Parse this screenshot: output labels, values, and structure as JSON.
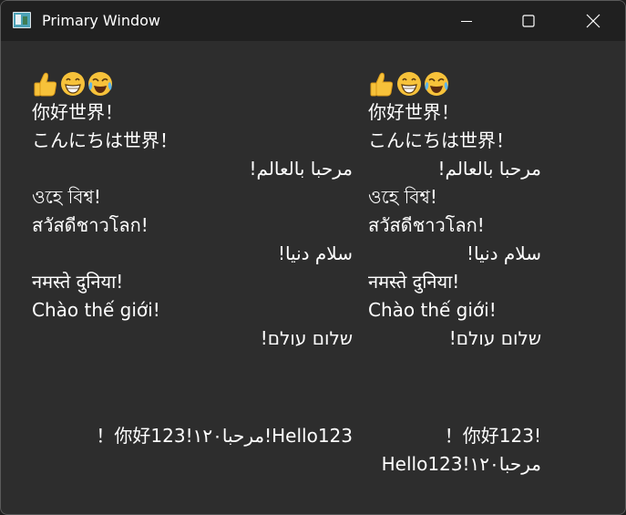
{
  "window": {
    "title": "Primary Window",
    "icons": {
      "app": "window-app-icon",
      "minimize": "minimize-icon",
      "maximize": "maximize-icon",
      "close": "close-icon"
    }
  },
  "emojis": [
    "thumbs-up-icon",
    "grinning-face-icon",
    "tears-of-joy-face-icon"
  ],
  "lines": [
    {
      "text": "你好世界！",
      "dir": "ltr"
    },
    {
      "text": "こんにちは世界！",
      "dir": "ltr"
    },
    {
      "text": "مرحبا بالعالم!",
      "dir": "rtl"
    },
    {
      "text": "ওহে বিশ্ব!",
      "dir": "ltr"
    },
    {
      "text": "สวัสดีชาวโลก!",
      "dir": "ltr"
    },
    {
      "text": "سلام دنیا!",
      "dir": "rtl"
    },
    {
      "text": "नमस्ते दुनिया!",
      "dir": "ltr"
    },
    {
      "text": "Chào thế giới!",
      "dir": "ltr"
    },
    {
      "text": "שלום עולם!",
      "dir": "rtl"
    }
  ],
  "mixed": {
    "left": "Hello123!مرحبا١٢٠!你好123！",
    "right_line1": "!你好123！",
    "right_line2": "Hello123!مرحبا١٢٠"
  },
  "colors": {
    "background": "#2d2d2d",
    "titlebar": "#202020",
    "text": "#ffffff"
  }
}
